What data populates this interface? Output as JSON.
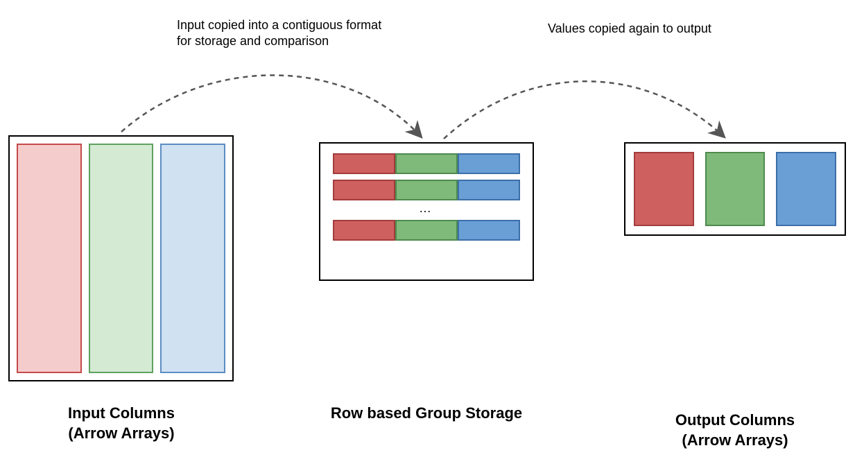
{
  "annotations": {
    "left": "Input copied into a contiguous format for storage and comparison",
    "right": "Values copied again to output"
  },
  "captions": {
    "input": "Input Columns\n(Arrow Arrays)",
    "middle": "Row based Group Storage",
    "output": "Output Columns\n(Arrow Arrays)"
  },
  "ellipsis": "…",
  "colors": {
    "red_fill_light": "#f5cccc",
    "green_fill_light": "#d4ead3",
    "blue_fill_light": "#d0e1f2",
    "red_fill": "#ce6060",
    "green_fill": "#7fba7a",
    "blue_fill": "#6a9fd6"
  }
}
